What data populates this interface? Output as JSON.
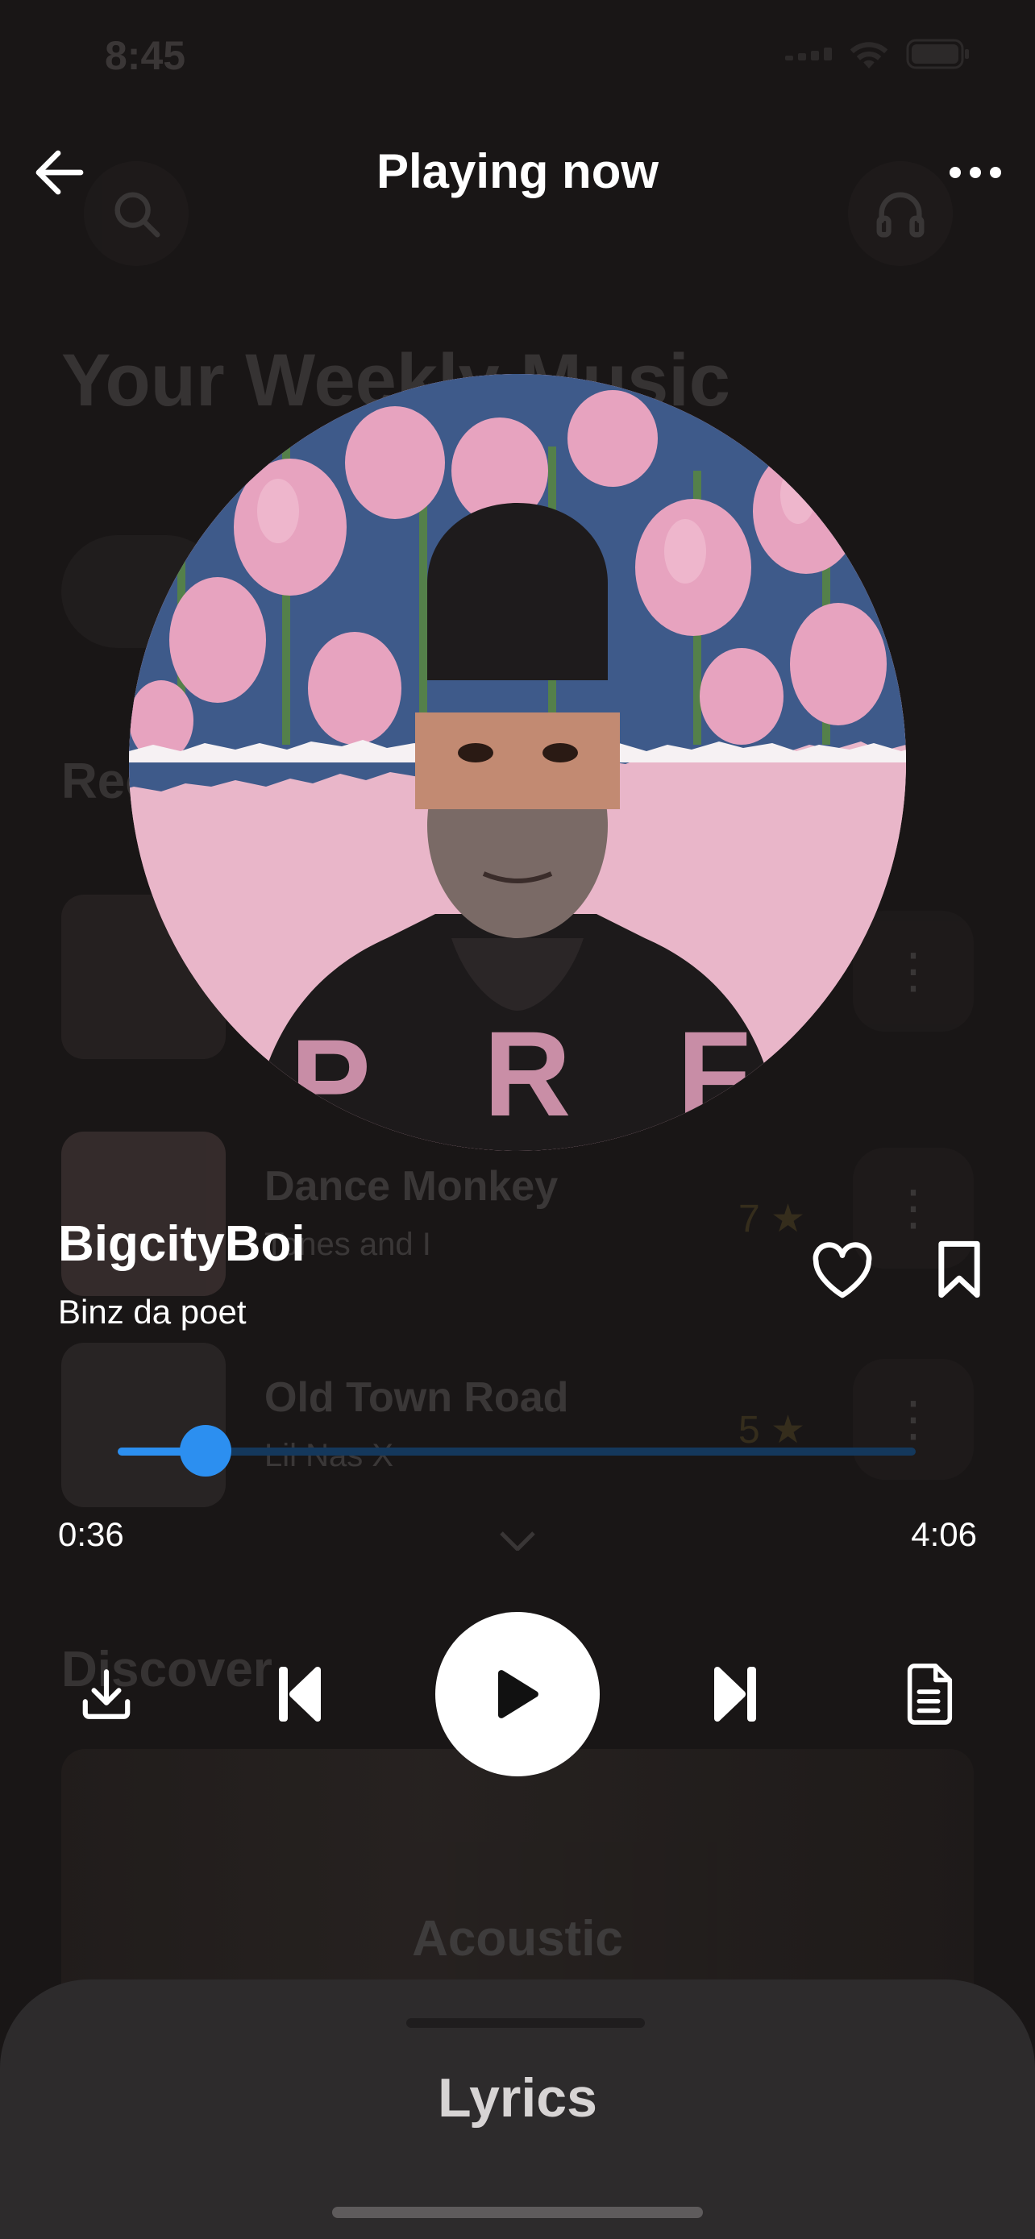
{
  "status_bar": {
    "time": "8:45"
  },
  "header": {
    "title": "Playing now"
  },
  "track": {
    "title": "BigcityBoi",
    "artist": "Binz da poet",
    "progress_fraction": 0.11,
    "elapsed": "0:36",
    "total": "4:06"
  },
  "lyrics_sheet": {
    "title": "Lyrics"
  },
  "background_page": {
    "heading": "Your Weekly Music",
    "sections": [
      "Rec",
      "Discover"
    ],
    "rows": [
      {
        "title": "",
        "subtitle": "",
        "rating": ""
      },
      {
        "title": "Dance Monkey",
        "subtitle": "Tones and I",
        "rating": "7"
      },
      {
        "title": "Old Town Road",
        "subtitle": "Lil Nas X",
        "rating": "5"
      }
    ],
    "banner_label": "Acoustic"
  },
  "colors": {
    "background": "#191616",
    "accent": "#2c8ff0",
    "progress_track": "#14385c",
    "sheet": "#2d2b2c",
    "rating_star": "#c7a640"
  },
  "icons": {
    "back": "arrow-left-icon",
    "more": "more-horizontal-icon",
    "like": "heart-icon",
    "bookmark": "bookmark-icon",
    "download": "download-icon",
    "previous": "skip-previous-icon",
    "play": "play-icon",
    "next": "skip-next-icon",
    "lyrics": "document-icon"
  }
}
